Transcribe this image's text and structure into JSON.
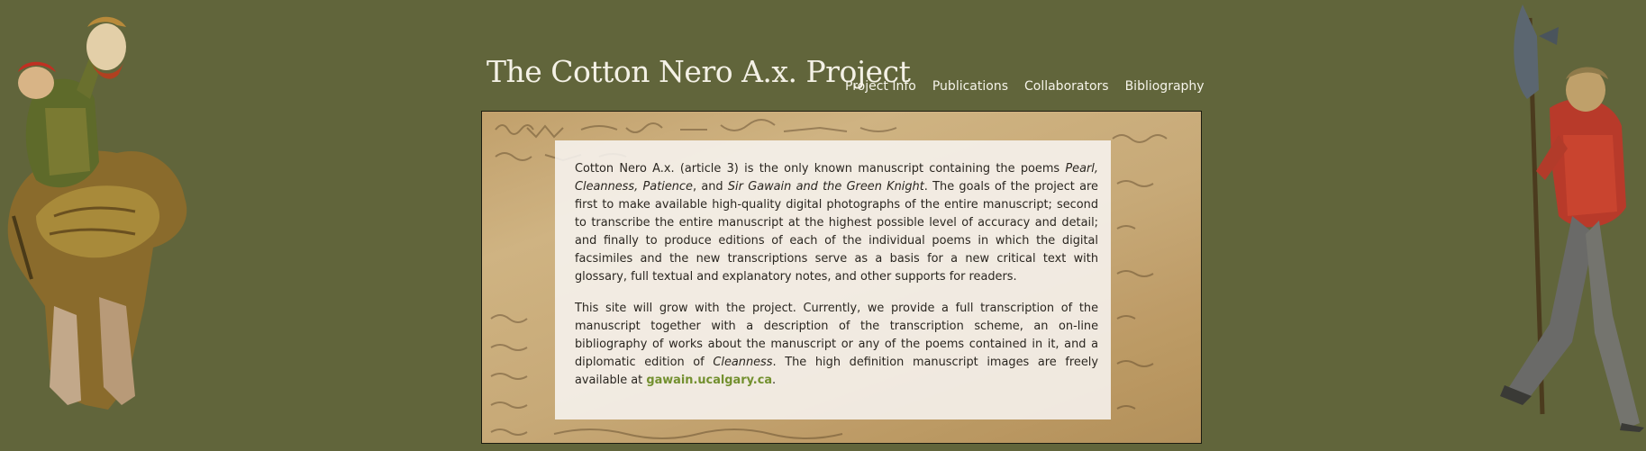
{
  "header": {
    "title": "The Cotton Nero A.x. Project"
  },
  "nav": {
    "items": [
      {
        "label": "Project Info"
      },
      {
        "label": "Publications"
      },
      {
        "label": "Collaborators"
      },
      {
        "label": "Bibliography"
      }
    ]
  },
  "intro": {
    "p1": {
      "t1": "Cotton Nero A.x. (article 3) is the only known manuscript containing the poems ",
      "pearl": "Pearl,",
      "t2": " ",
      "cleanness": "Cleanness,",
      "t3": " ",
      "patience": "Patience",
      "t4": ", and ",
      "gawain": "Sir Gawain and the Green Knight",
      "t5": ". The goals of the project are first to make available high-quality digital photographs of the entire manuscript; second to transcribe the entire manuscript at the highest possible level of accuracy and detail; and finally to produce editions of each of the individual poems in which the digital facsimiles and the new transcriptions serve as a basis for a new critical text with glossary, full textual and explanatory notes, and other supports for readers."
    },
    "p2": {
      "t1": "This site will grow with the project. Currently, we provide a full transcription of the manuscript together with a description of the transcription scheme, an on-line bibliography of works about the manuscript or any of the poems contained in it, and a diplomatic edition of ",
      "cleanness": "Cleanness",
      "t2": ". The high definition manuscript images are freely available at ",
      "link": "gawain.ucalgary.ca",
      "t3": "."
    }
  },
  "icons": {
    "left_figure": "knight-with-head-icon",
    "right_figure": "axeman-icon"
  },
  "colors": {
    "background": "#61653b",
    "link": "#73902f",
    "parchment": "#ceaf7b"
  }
}
